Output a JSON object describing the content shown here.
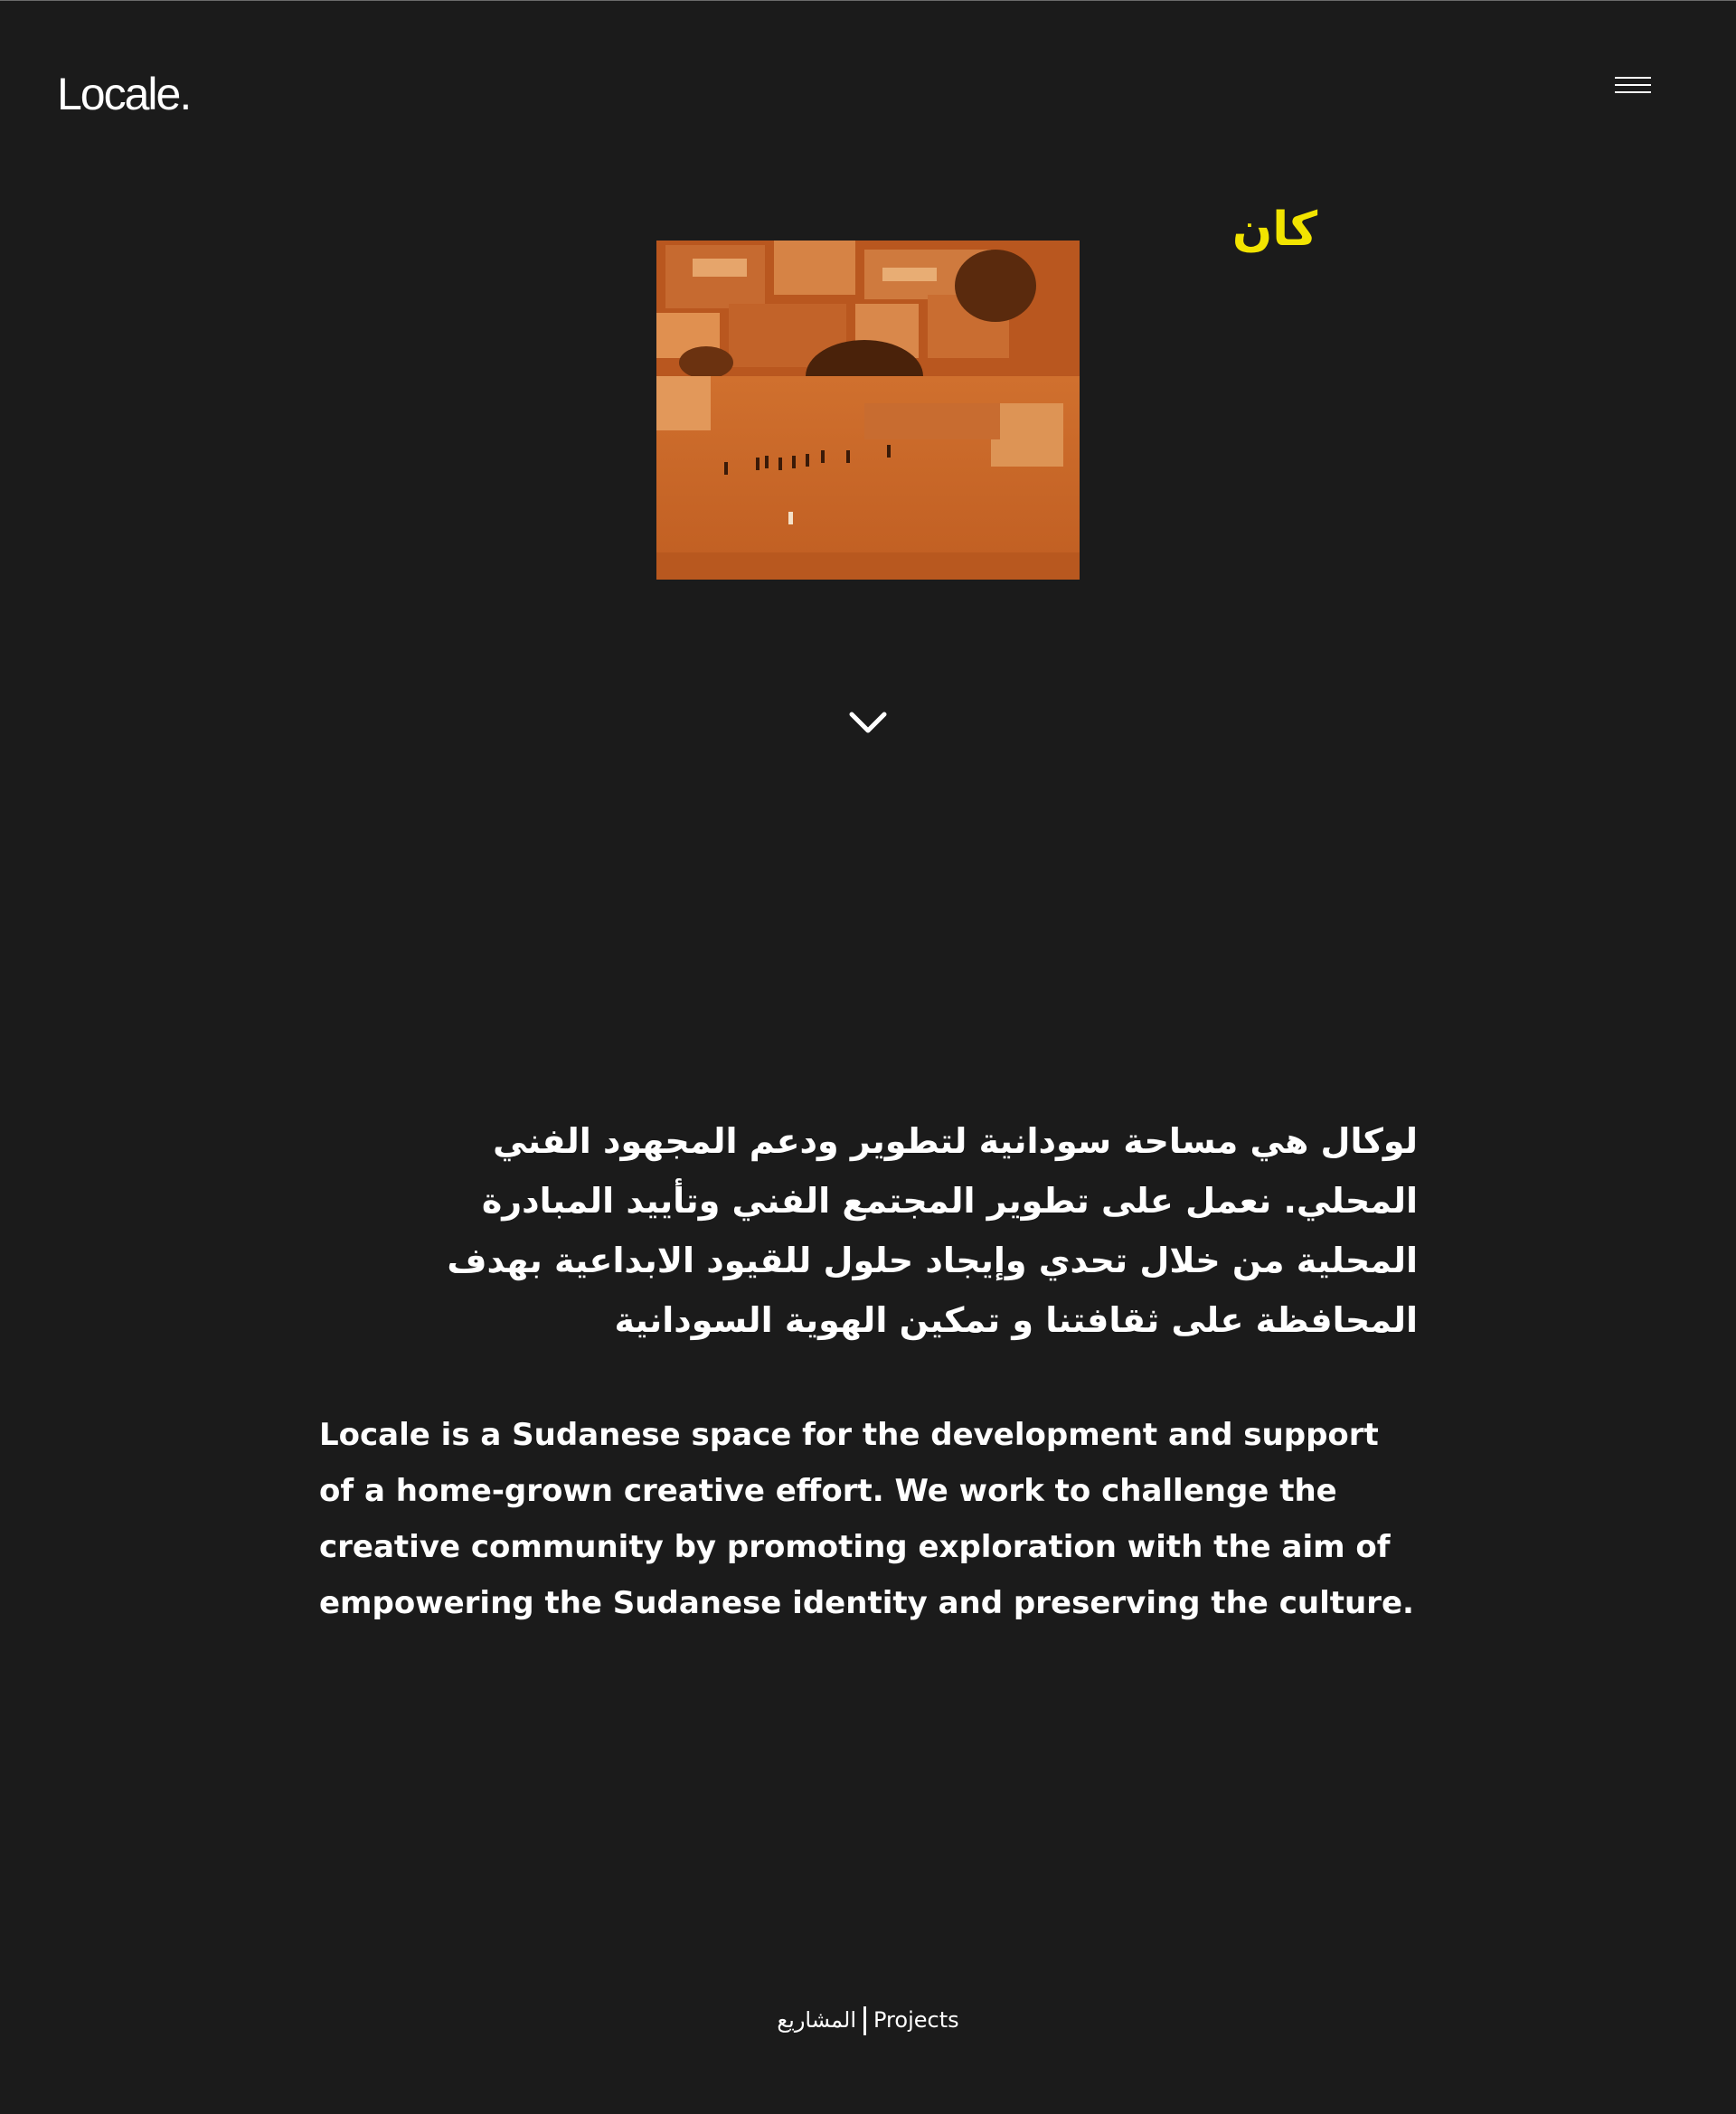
{
  "header": {
    "logo_text": "Locale.",
    "menu_icon": "hamburger-menu-icon"
  },
  "hero": {
    "arabic_word": "كان",
    "arabic_word_color": "#f2e400",
    "image_description_icon": "sudanese-village-photo",
    "scroll_icon": "chevron-down-icon"
  },
  "about": {
    "arabic_text": "لوكال هي مساحة سودانية لتطوير ودعم المجهود الفني المحلي. نعمل على تطوير المجتمع الفني وتأييد المبادرة المحلية من خلال تحدي وإيجاد حلول للقيود الابداعية بهدف المحافظة على ثقافتنا و تمكين الهوية السودانية",
    "english_text": "Locale is a Sudanese space for the development and support of a home-grown creative effort. We work to challenge the creative community by promoting exploration with the aim of empowering the Sudanese identity and preserving the culture."
  },
  "footer": {
    "projects_ar": "المشاريع",
    "projects_en": "Projects"
  },
  "colors": {
    "background": "#1b1b1b",
    "text": "#ffffff",
    "accent": "#f2e400",
    "image_tone": "#c8622a"
  }
}
